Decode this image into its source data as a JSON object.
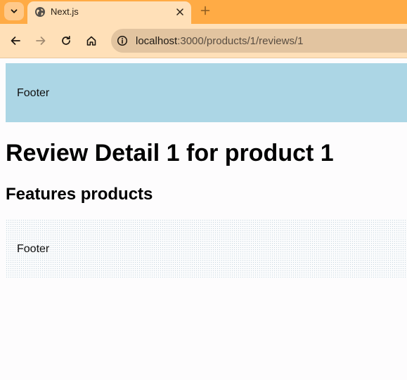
{
  "browser": {
    "tab": {
      "title": "Next.js"
    },
    "address_bar": {
      "host": "localhost",
      "path": ":3000/products/1/reviews/1"
    }
  },
  "page": {
    "footer_top": {
      "label": "Footer",
      "background": "#acd6e5"
    },
    "heading": "Review Detail 1 for product 1",
    "subheading": "Features products",
    "footer_bottom": {
      "label": "Footer"
    }
  },
  "theme": {
    "tabstrip": "#ffab45",
    "toolbar": "#ffe0b8",
    "omnibox": "#e2c4a0"
  }
}
